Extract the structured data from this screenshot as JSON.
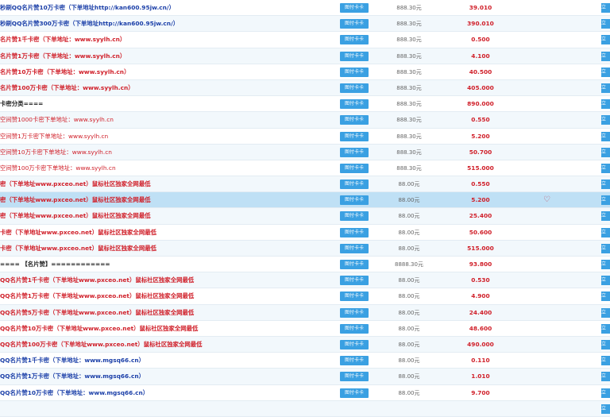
{
  "buy_label": "图付卡卡",
  "edge_label": "立",
  "rows": [
    {
      "name": "秒刷QQ名片赞10万卡密（下单地址http://kan600.95jw.cn/）",
      "color": "blue",
      "price": "888.30元",
      "stock": "39.010"
    },
    {
      "name": "秒刷QQ名片赞300万卡密（下单地址http://kan600.95jw.cn/）",
      "color": "blue",
      "price": "888.30元",
      "stock": "390.010"
    },
    {
      "name": "名片赞1千卡密（下单地址：www.syylh.cn）",
      "color": "red",
      "price": "888.30元",
      "stock": "0.500"
    },
    {
      "name": "名片赞1万卡密（下单地址：www.syylh.cn）",
      "color": "red",
      "price": "888.30元",
      "stock": "4.100"
    },
    {
      "name": "名片赞10万卡密（下单地址：www.syylh.cn）",
      "color": "red",
      "price": "888.30元",
      "stock": "40.500"
    },
    {
      "name": "名片赞100万卡密（下单地址：www.syylh.cn）",
      "color": "red",
      "price": "888.30元",
      "stock": "405.000"
    },
    {
      "name": "卡密分类====",
      "color": "dark",
      "price": "888.30元",
      "stock": "890.000"
    },
    {
      "name": "空间赞1000卡密下单地址：www.syylh.cn",
      "color": "red",
      "thin": true,
      "price": "888.30元",
      "stock": "0.550"
    },
    {
      "name": "空间赞1万卡密下单地址：www.syylh.cn",
      "color": "red",
      "thin": true,
      "price": "888.30元",
      "stock": "5.200"
    },
    {
      "name": "空间赞10万卡密下单地址：www.syylh.cn",
      "color": "red",
      "thin": true,
      "price": "888.30元",
      "stock": "50.700"
    },
    {
      "name": "空间赞100万卡密下单地址：www.syylh.cn",
      "color": "red",
      "thin": true,
      "price": "888.30元",
      "stock": "515.000"
    },
    {
      "name": "密（下单地址www.pxceo.net）鼠标社区独家全网最低",
      "color": "red",
      "price": "88.00元",
      "stock": "0.550"
    },
    {
      "name": "密（下单地址www.pxceo.net）鼠标社区独家全网最低",
      "color": "red",
      "price": "88.00元",
      "stock": "5.200",
      "selected": true,
      "heart": "♡"
    },
    {
      "name": "密（下单地址www.pxceo.net）鼠标社区独家全网最低",
      "color": "red",
      "price": "88.00元",
      "stock": "25.400"
    },
    {
      "name": "卡密（下单地址www.pxceo.net）鼠标社区独家全网最低",
      "color": "red",
      "price": "88.00元",
      "stock": "50.600"
    },
    {
      "name": "卡密（下单地址www.pxceo.net）鼠标社区独家全网最低",
      "color": "red",
      "price": "88.00元",
      "stock": "515.000"
    },
    {
      "name": "==== 【名片赞】============",
      "color": "dark",
      "price": "8888.30元",
      "stock": "93.800"
    },
    {
      "name": "QQ名片赞1千卡密（下单地址www.pxceo.net）鼠标社区独家全网最低",
      "color": "red",
      "price": "88.00元",
      "stock": "0.530"
    },
    {
      "name": "QQ名片赞1万卡密（下单地址www.pxceo.net）鼠标社区独家全网最低",
      "color": "red",
      "price": "88.00元",
      "stock": "4.900"
    },
    {
      "name": "QQ名片赞5万卡密（下单地址www.pxceo.net）鼠标社区独家全网最低",
      "color": "red",
      "price": "88.00元",
      "stock": "24.400"
    },
    {
      "name": "QQ名片赞10万卡密（下单地址www.pxceo.net）鼠标社区独家全网最低",
      "color": "red",
      "price": "88.00元",
      "stock": "48.600"
    },
    {
      "name": "QQ名片赞100万卡密（下单地址www.pxceo.net）鼠标社区独家全网最低",
      "color": "red",
      "price": "88.00元",
      "stock": "490.000"
    },
    {
      "name": "QQ名片赞1千卡密（下单地址：www.mgsq66.cn）",
      "color": "blue",
      "price": "88.00元",
      "stock": "0.110"
    },
    {
      "name": "QQ名片赞1万卡密（下单地址：www.mgsq66.cn）",
      "color": "blue",
      "price": "88.00元",
      "stock": "1.010"
    },
    {
      "name": "QQ名片赞10万卡密（下单地址：www.mgsq66.cn）",
      "color": "blue",
      "price": "88.00元",
      "stock": "9.700"
    },
    {
      "name": "",
      "color": "blue",
      "price": "",
      "stock": ""
    }
  ]
}
